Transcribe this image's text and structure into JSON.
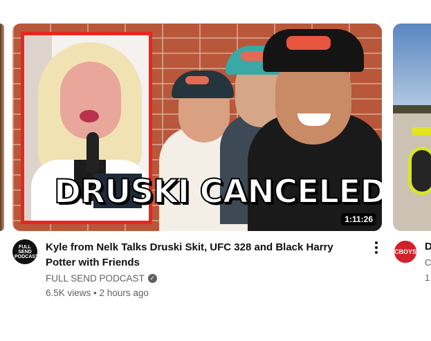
{
  "thumbnail": {
    "overlay_text": "DRUSKI CANCELED?!",
    "duration": "1:11:26"
  },
  "video": {
    "title": "Kyle from Nelk Talks Druski Skit, UFC 328 and Black Harry Potter with Friends",
    "channel": "FULL SEND PODCAST",
    "verified": true,
    "views": "6.5K views",
    "separator": "•",
    "age": "2 hours ago",
    "avatar_text": "FULL SEND PODCAST"
  },
  "next_video": {
    "avatar_text": "CBOYS",
    "title_peek": "D",
    "line2_peek": "C",
    "line3_peek": "1"
  },
  "colors": {
    "inset_border": "#e8261f",
    "brick": "#b9573a",
    "meta_text": "#606060"
  },
  "icons": {
    "more": "kebab-vertical-icon",
    "verified": "check-badge-icon"
  }
}
